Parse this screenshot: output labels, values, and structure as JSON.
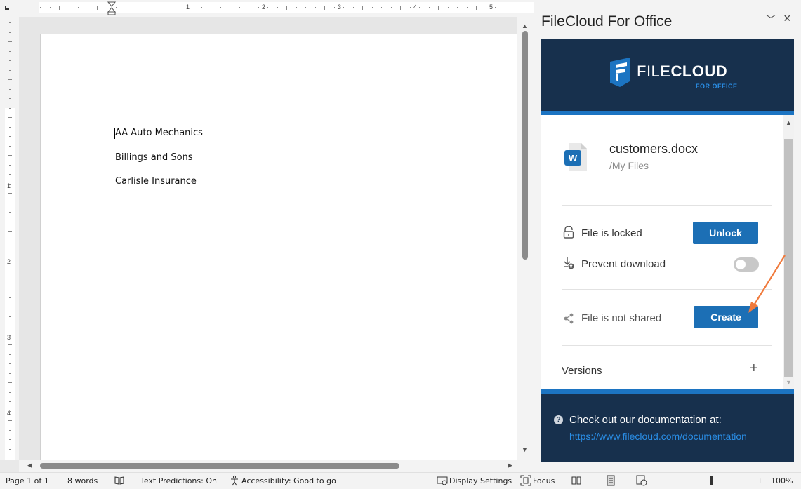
{
  "document": {
    "lines": [
      "AA Auto Mechanics",
      "Billings and Sons",
      "Carlisle Insurance"
    ],
    "ruler_numbers": [
      "1",
      "2",
      "3",
      "4",
      "5"
    ],
    "vruler_numbers": [
      "1",
      "2",
      "3",
      "4"
    ]
  },
  "pane": {
    "title": "FileCloud For Office",
    "logo_light": "FILE",
    "logo_bold": "CLOUD",
    "logo_sub": "FOR OFFICE",
    "file": {
      "icon_letter": "W",
      "name": "customers.docx",
      "path": "/My Files"
    },
    "lock_label": "File is locked",
    "unlock_button": "Unlock",
    "prevent_download_label": "Prevent download",
    "prevent_download_on": false,
    "share_label": "File is not shared",
    "create_button": "Create",
    "versions_label": "Versions",
    "versions_add": "+",
    "footer_text": "Check out our documentation at:",
    "footer_link": "https://www.filecloud.com/documentation",
    "colors": {
      "header_bg": "#17304d",
      "accent_stripe": "#1c74c2",
      "button": "#1c6fb5",
      "annotation_arrow": "#f07a3c"
    }
  },
  "status_bar": {
    "page": "Page 1 of 1",
    "words": "8 words",
    "text_predictions": "Text Predictions: On",
    "accessibility": "Accessibility: Good to go",
    "display_settings": "Display Settings",
    "focus": "Focus",
    "zoom_minus": "−",
    "zoom_plus": "+",
    "zoom": "100%"
  }
}
